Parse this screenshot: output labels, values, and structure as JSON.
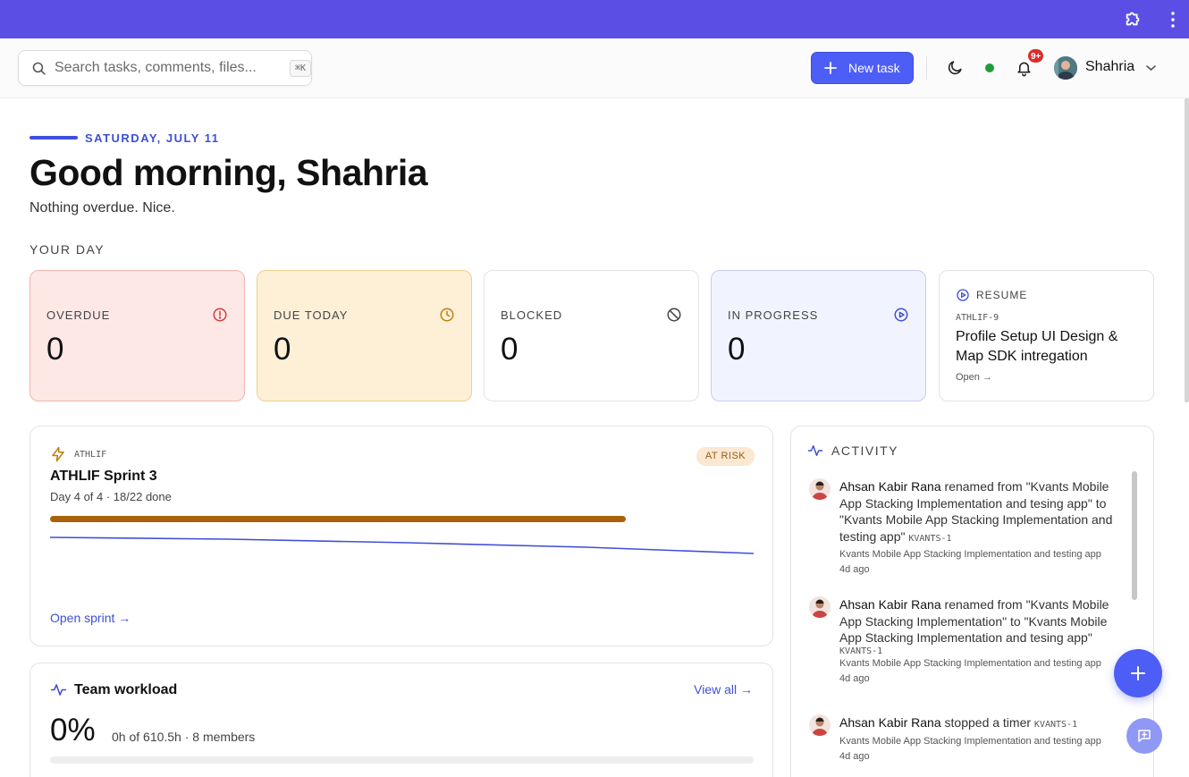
{
  "search": {
    "placeholder": "Search tasks, comments, files...",
    "shortcut": "⌘K"
  },
  "header": {
    "new_task_label": "New task",
    "notification_count": "9+",
    "user_name": "Shahria",
    "status_color": "#1f9d3a"
  },
  "greeting": {
    "date": "SATURDAY, JULY 11",
    "title": "Good morning, Shahria",
    "subtitle": "Nothing overdue. Nice.",
    "section_label": "YOUR DAY"
  },
  "stats": {
    "overdue": {
      "label": "OVERDUE",
      "value": "0",
      "icon": "alert-circle-icon"
    },
    "due_today": {
      "label": "DUE TODAY",
      "value": "0",
      "icon": "clock-icon"
    },
    "blocked": {
      "label": "BLOCKED",
      "value": "0",
      "icon": "ban-icon"
    },
    "in_progress": {
      "label": "IN PROGRESS",
      "value": "0",
      "icon": "play-circle-icon"
    }
  },
  "resume": {
    "label": "RESUME",
    "task_key": "ATHLIF-9",
    "task_title": "Profile Setup UI Design & Map SDK intregation",
    "open_label": "Open →"
  },
  "sprint": {
    "project": "ATHLIF",
    "title": "ATHLIF Sprint 3",
    "meta": "Day 4 of 4 · 18/22 done",
    "status": "AT RISK",
    "done": 18,
    "total": 22,
    "open_label": "Open sprint →"
  },
  "workload": {
    "title": "Team workload",
    "view_all": "View all →",
    "percent": "0%",
    "meta": "0h of 610.5h · 8 members",
    "utilization": 0
  },
  "activity": {
    "title": "ACTIVITY",
    "items": [
      {
        "user": "Ahsan Kabir Rana",
        "text": " renamed from \"Kvants Mobile App Stacking Implementation and tesing app\" to \"Kvants Mobile App Stacking Implementation and testing app\" ",
        "key": "KVANTS-1",
        "project": "Kvants Mobile App Stacking Implementation and testing app",
        "ago": "4d ago"
      },
      {
        "user": "Ahsan Kabir Rana",
        "text": " renamed from \"Kvants Mobile App Stacking Implementation\" to \"Kvants Mobile App Stacking Implementation and tesing app\"",
        "key": "KVANTS-1",
        "project": "Kvants Mobile App Stacking Implementation and testing app",
        "ago": "4d ago"
      },
      {
        "user": "Ahsan Kabir Rana",
        "text": " stopped a timer ",
        "key": "KVANTS-1",
        "project": "Kvants Mobile App Stacking Implementation and testing app",
        "ago": "4d ago"
      }
    ]
  },
  "colors": {
    "topbar": "#5b4ee5",
    "accent": "#4d5ef6",
    "sprint_progress": "#a9620c",
    "burndown_line": "#3f4fd6"
  }
}
